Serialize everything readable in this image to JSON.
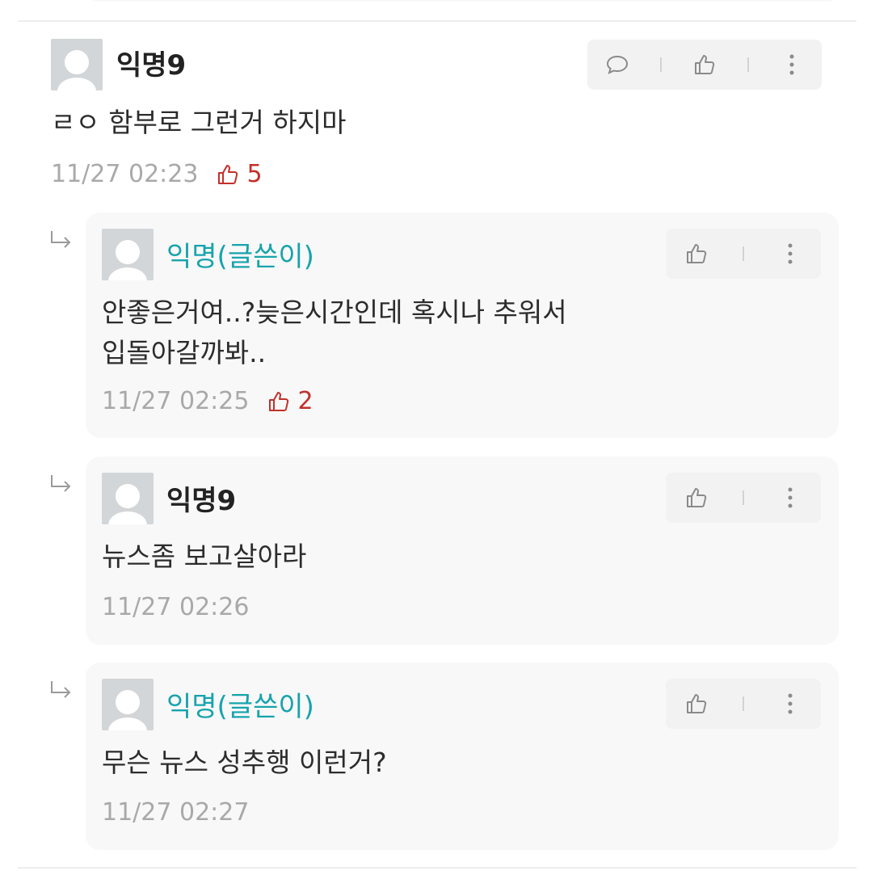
{
  "comments": [
    {
      "nickname": "익명9",
      "text": "ㄹㅇ 함부로 그런거 하지마",
      "time": "11/27 02:23",
      "likes": "5"
    }
  ],
  "replies": [
    {
      "nickname": "익명(글쓴이)",
      "is_author": true,
      "text_line1": "안좋은거여..?늦은시간인데 혹시나 추워서",
      "text_line2": "입돌아갈까봐..",
      "time": "11/27 02:25",
      "likes": "2"
    },
    {
      "nickname": "익명9",
      "is_author": false,
      "text_line1": "뉴스좀 보고살아라",
      "time": "11/27 02:26"
    },
    {
      "nickname": "익명(글쓴이)",
      "is_author": true,
      "text_line1": "무슨 뉴스 성추행 이런거?",
      "time": "11/27 02:27"
    }
  ],
  "icons": {
    "reply": "speech-bubble-icon",
    "like": "thumbs-up-icon",
    "more": "vertical-dots-icon",
    "reply_marker": "reply-arrow-icon"
  },
  "colors": {
    "author_name": "#17a3ad",
    "like_count": "#c2302a",
    "meta_text": "#a9a9a9"
  }
}
